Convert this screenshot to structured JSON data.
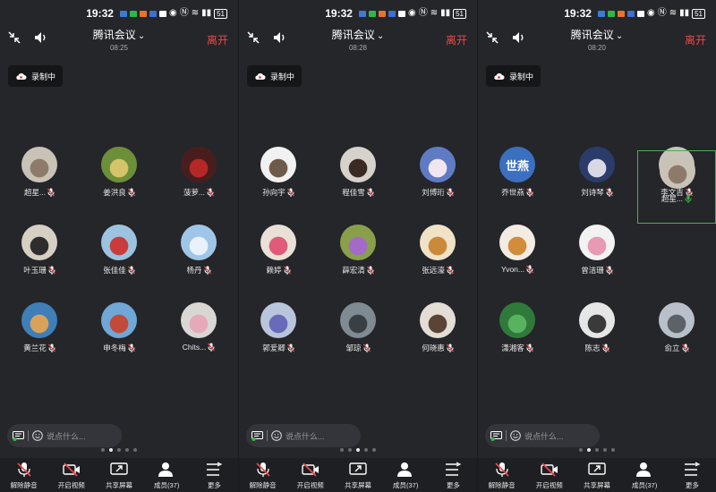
{
  "status": {
    "time": "19:32",
    "battery": "51"
  },
  "meeting": {
    "title": "腾讯会议",
    "leave": "离开",
    "recording": "录制中",
    "chat_placeholder": "说点什么..."
  },
  "toolbar": {
    "unmute": "解除静音",
    "video": "开启视频",
    "share": "共享屏幕",
    "members": "成员(37)",
    "more": "更多"
  },
  "screens": [
    {
      "duration": "08:25",
      "active_page": 1,
      "participants": [
        {
          "name": "超星...",
          "color": "#c9c2b6",
          "accent": "#8d7a6a"
        },
        {
          "name": "姜洪良",
          "color": "#6c8f3a",
          "accent": "#d6c46a"
        },
        {
          "name": "菠萝...",
          "color": "#4a1d1d",
          "accent": "#b52828"
        },
        {
          "name": "叶玉珊",
          "color": "#d7cfc4",
          "accent": "#2e2e2e"
        },
        {
          "name": "张佳佳",
          "color": "#9cc3e0",
          "accent": "#c83c3c"
        },
        {
          "name": "杨丹",
          "color": "#9fc6e8",
          "accent": "#e9f2fa"
        },
        {
          "name": "黄兰花",
          "color": "#3f7fb8",
          "accent": "#d9a25a"
        },
        {
          "name": "申冬梅",
          "color": "#6fa7d6",
          "accent": "#c24a3a"
        },
        {
          "name": "Chits...",
          "color": "#d9d7d4",
          "accent": "#e7a9b9"
        }
      ]
    },
    {
      "duration": "08:28",
      "active_page": 2,
      "participants": [
        {
          "name": "孙向宇",
          "color": "#f1f1f1",
          "accent": "#6e5a4a"
        },
        {
          "name": "程佳雪",
          "color": "#d8d2cc",
          "accent": "#3a2a24"
        },
        {
          "name": "刘博珩",
          "color": "#5f7bc4",
          "accent": "#f0e6f0"
        },
        {
          "name": "赖婷",
          "color": "#e9e0d6",
          "accent": "#e05a7a"
        },
        {
          "name": "薛宏清",
          "color": "#8a9f4a",
          "accent": "#a46ac8"
        },
        {
          "name": "张远濠",
          "color": "#efe2c6",
          "accent": "#c98a3a"
        },
        {
          "name": "郭爱卿",
          "color": "#b9c5dc",
          "accent": "#6a6ab8"
        },
        {
          "name": "邹琼",
          "color": "#7e8b93",
          "accent": "#3a3f44"
        },
        {
          "name": "何晓惠",
          "color": "#e3ddd6",
          "accent": "#5a4436"
        }
      ]
    },
    {
      "duration": "08:20",
      "active_page": 1,
      "participants": [
        {
          "name": "乔世燕",
          "avatar_text": "世燕",
          "color": "#3b6fc0",
          "accent": "#3b6fc0"
        },
        {
          "name": "刘诗琴",
          "color": "#2a3c6a",
          "accent": "#d9d9e6"
        },
        {
          "name": "李文吉",
          "color": "#c9c3bb",
          "accent": "#24262b"
        },
        {
          "name": "Yvon...",
          "color": "#f3ece2",
          "accent": "#d38c3b"
        },
        {
          "name": "曾洁珊",
          "color": "#f2f2f2",
          "accent": "#e79ab3"
        },
        {
          "name": "超星...",
          "color": "#c9c2b6",
          "accent": "#8d7a6a",
          "speaking": true
        },
        {
          "name": "潇湘客",
          "color": "#2f7a3a",
          "accent": "#59b25e"
        },
        {
          "name": "陈志",
          "color": "#e6e6e6",
          "accent": "#3a3a3a"
        },
        {
          "name": "俞立",
          "color": "#b8c0c9",
          "accent": "#5d6168"
        }
      ]
    }
  ]
}
